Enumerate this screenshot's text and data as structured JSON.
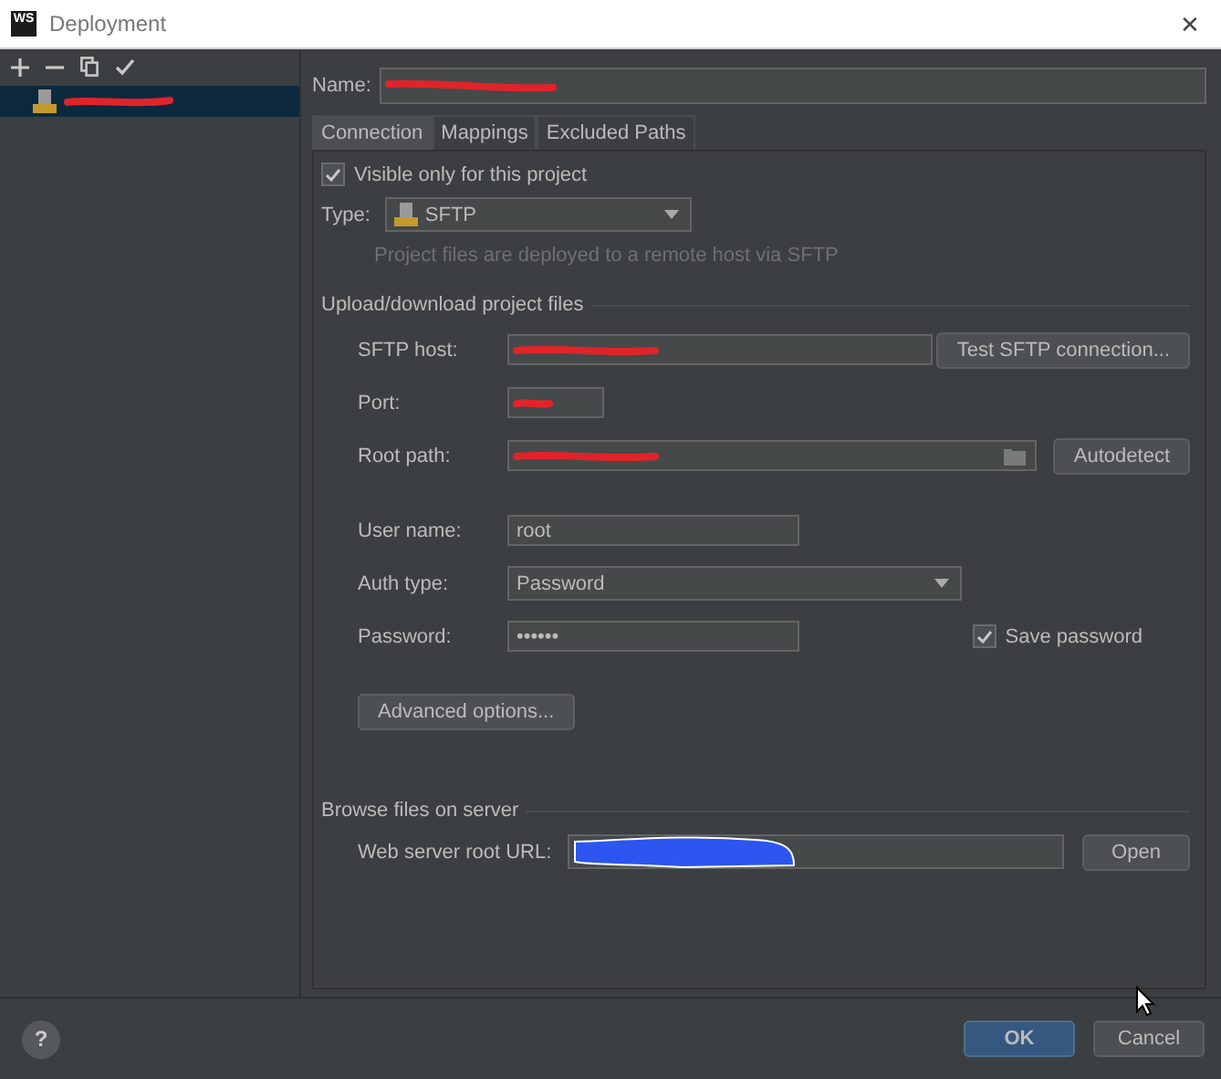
{
  "window": {
    "logo": "WS",
    "title": "Deployment",
    "close": "✕"
  },
  "sidebar": {
    "items": [
      {
        "selected": true,
        "redacted": true
      }
    ]
  },
  "name_field": {
    "label": "Name:",
    "redacted": true
  },
  "tabs": [
    {
      "label": "Connection",
      "selected": true
    },
    {
      "label": "Mappings",
      "selected": false
    },
    {
      "label": "Excluded Paths",
      "selected": false
    }
  ],
  "visible_only": {
    "label": "Visible only for this project",
    "checked": true
  },
  "type_field": {
    "label": "Type:",
    "value": "SFTP"
  },
  "type_hint": "Project files are deployed to a remote host via SFTP",
  "upload_section": {
    "title": "Upload/download project files",
    "rows": [
      {
        "kind": "text",
        "label": "SFTP host:",
        "redacted": true,
        "button": "Test SFTP connection..."
      },
      {
        "kind": "text",
        "label": "Port:",
        "redacted": true
      },
      {
        "kind": "path",
        "label": "Root path:",
        "redacted": true,
        "button": "Autodetect"
      },
      {
        "kind": "text",
        "label": "User name:",
        "value": "root"
      },
      {
        "kind": "select",
        "label": "Auth type:",
        "value": "Password"
      },
      {
        "kind": "password",
        "label": "Password:",
        "value": "••••••",
        "checkbox": {
          "label": "Save password",
          "checked": true
        }
      }
    ],
    "advanced_button": "Advanced options..."
  },
  "browse_section": {
    "title": "Browse files on server",
    "label": "Web server root URL:",
    "redacted": true,
    "button": "Open"
  },
  "footer": {
    "help": "?",
    "buttons": [
      {
        "label": "OK",
        "kind": "primary"
      },
      {
        "label": "Cancel",
        "kind": "normal"
      }
    ]
  }
}
